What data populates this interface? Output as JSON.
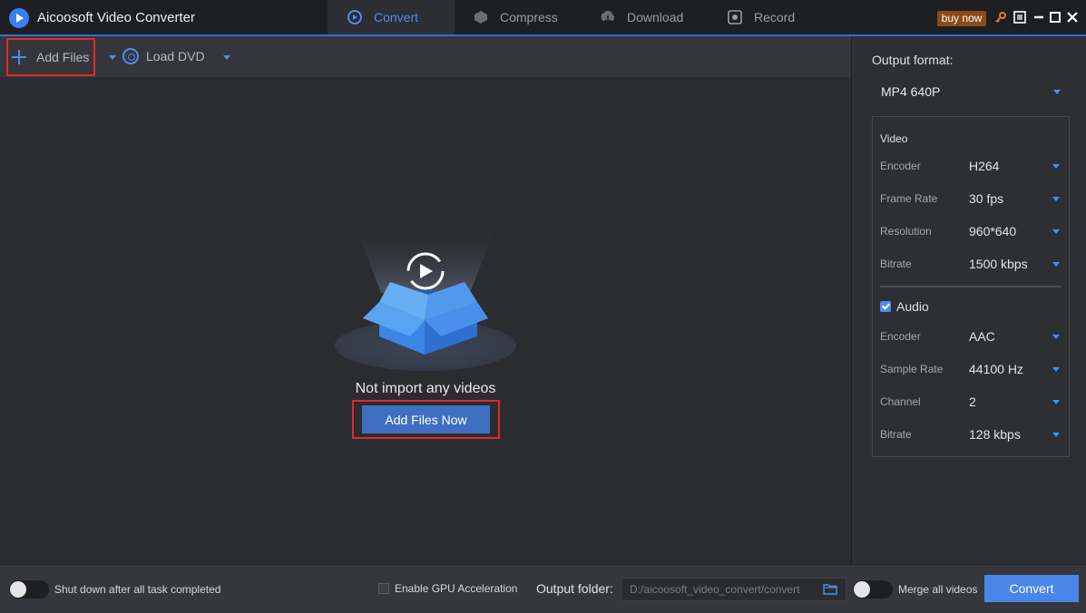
{
  "app": {
    "title": "Aicoosoft Video Converter",
    "buy_now": "buy now"
  },
  "tabs": [
    {
      "label": "Convert",
      "icon": "convert-icon",
      "active": true
    },
    {
      "label": "Compress",
      "icon": "compress-icon",
      "active": false
    },
    {
      "label": "Download",
      "icon": "download-icon",
      "active": false
    },
    {
      "label": "Record",
      "icon": "record-icon",
      "active": false
    }
  ],
  "toolbar": {
    "add_files": "Add Files",
    "load_dvd": "Load DVD"
  },
  "main": {
    "empty_message": "Not import any videos",
    "add_files_now": "Add Files Now"
  },
  "output": {
    "label": "Output format:",
    "format": "MP4 640P",
    "video": {
      "title": "Video",
      "rows": [
        {
          "label": "Encoder",
          "value": "H264"
        },
        {
          "label": "Frame Rate",
          "value": "30 fps"
        },
        {
          "label": "Resolution",
          "value": "960*640"
        },
        {
          "label": "Bitrate",
          "value": "1500 kbps"
        }
      ]
    },
    "audio": {
      "title": "Audio",
      "enabled": true,
      "rows": [
        {
          "label": "Encoder",
          "value": "AAC"
        },
        {
          "label": "Sample Rate",
          "value": "44100 Hz"
        },
        {
          "label": "Channel",
          "value": "2"
        },
        {
          "label": "Bitrate",
          "value": "128 kbps"
        }
      ]
    }
  },
  "bottom": {
    "shutdown": "Shut down after all task completed",
    "gpu": "Enable GPU Acceleration",
    "output_folder_label": "Output folder:",
    "output_folder_path": "D:/aicoosoft_video_convert/convert",
    "merge": "Merge all videos",
    "convert": "Convert"
  },
  "colors": {
    "accent": "#4d8df0",
    "highlight": "#e02a2a",
    "primary_button": "#3f6fc1"
  }
}
